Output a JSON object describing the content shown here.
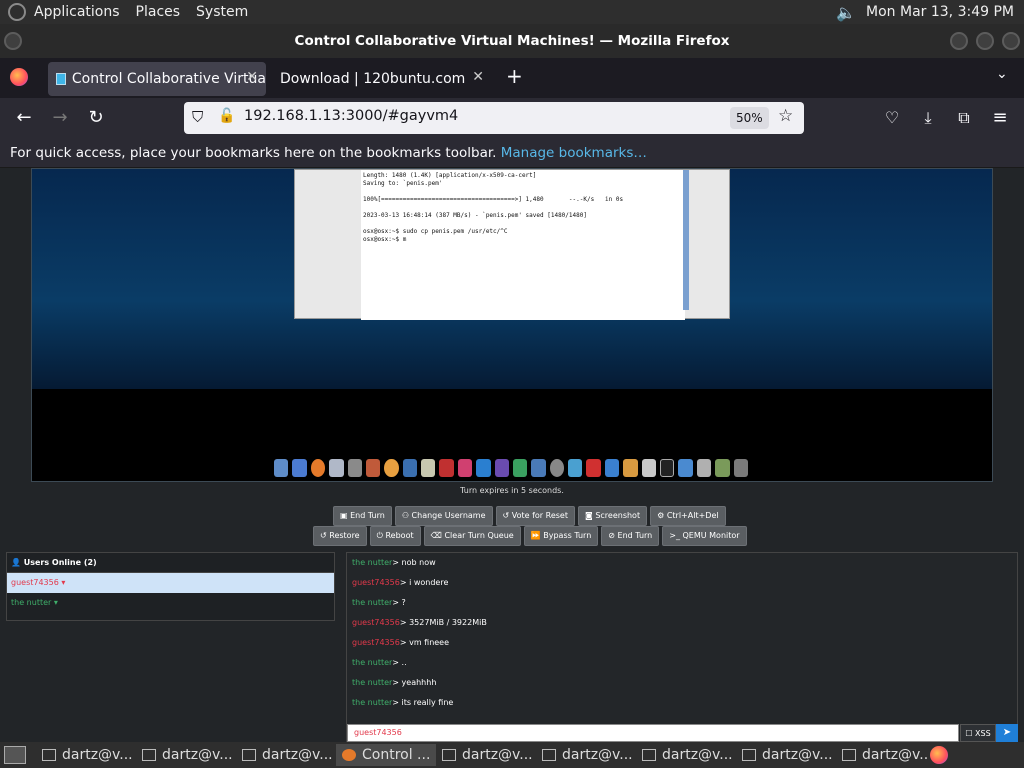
{
  "panel": {
    "menus": [
      "Applications",
      "Places",
      "System"
    ],
    "clock": "Mon Mar 13,  3:49 PM"
  },
  "window": {
    "title": "Control Collaborative Virtual Machines! — Mozilla Firefox"
  },
  "tabs": [
    {
      "label": "Control Collaborative Virtua",
      "active": true
    },
    {
      "label": "Download | 120buntu.com",
      "active": false
    }
  ],
  "nav": {
    "url": "192.168.1.13:3000/#gayvm4",
    "zoom": "50%"
  },
  "bookmarks": {
    "text": "For quick access, place your bookmarks here on the bookmarks toolbar. ",
    "link": "Manage bookmarks…"
  },
  "vm": {
    "terminal": "Length: 1480 (1.4K) [application/x-x509-ca-cert]\nSaving to: `penis.pem'\n\n100%[=====================================>] 1,480       --.-K/s   in 0s\n\n2023-03-13 16:48:14 (387 MB/s) - `penis.pem' saved [1480/1480]\n\nosx@osx:~$ sudo cp penis.pem /usr/etc/^C\nosx@osx:~$ m"
  },
  "turn_status": "Turn expires in 5 seconds.",
  "controls": {
    "row1": [
      "End Turn",
      "Change Username",
      "Vote for Reset",
      "Screenshot",
      "Ctrl+Alt+Del"
    ],
    "row2": [
      "Restore",
      "Reboot",
      "Clear Turn Queue",
      "Bypass Turn",
      "End Turn",
      "QEMU Monitor"
    ]
  },
  "users": {
    "header": "Users Online (2)",
    "list": [
      {
        "name": "guest74356",
        "selected": true
      },
      {
        "name": "the nutter",
        "selected": false
      }
    ]
  },
  "chat": {
    "messages": [
      {
        "user": "the nutter",
        "sep": "> ",
        "text": "nob now"
      },
      {
        "user": "guest74356",
        "sep": "> ",
        "text": "i wondere"
      },
      {
        "user": "the nutter",
        "sep": "> ",
        "text": "?"
      },
      {
        "user": "guest74356",
        "sep": "> ",
        "text": "3527MiB / 3922MiB"
      },
      {
        "user": "guest74356",
        "sep": "> ",
        "text": "vm fineee"
      },
      {
        "user": "the nutter",
        "sep": "> ",
        "text": ".."
      },
      {
        "user": "the nutter",
        "sep": "> ",
        "text": "yeahhhh"
      },
      {
        "user": "the nutter",
        "sep": "> ",
        "text": "its really fine"
      }
    ],
    "input_placeholder": "guest74356",
    "xss_label": "XSS"
  },
  "taskbar": {
    "tasks": [
      "dartz@v...",
      "dartz@v...",
      "dartz@v...",
      "Control ...",
      "dartz@v...",
      "dartz@v...",
      "dartz@v...",
      "dartz@v...",
      "dartz@v..."
    ]
  }
}
